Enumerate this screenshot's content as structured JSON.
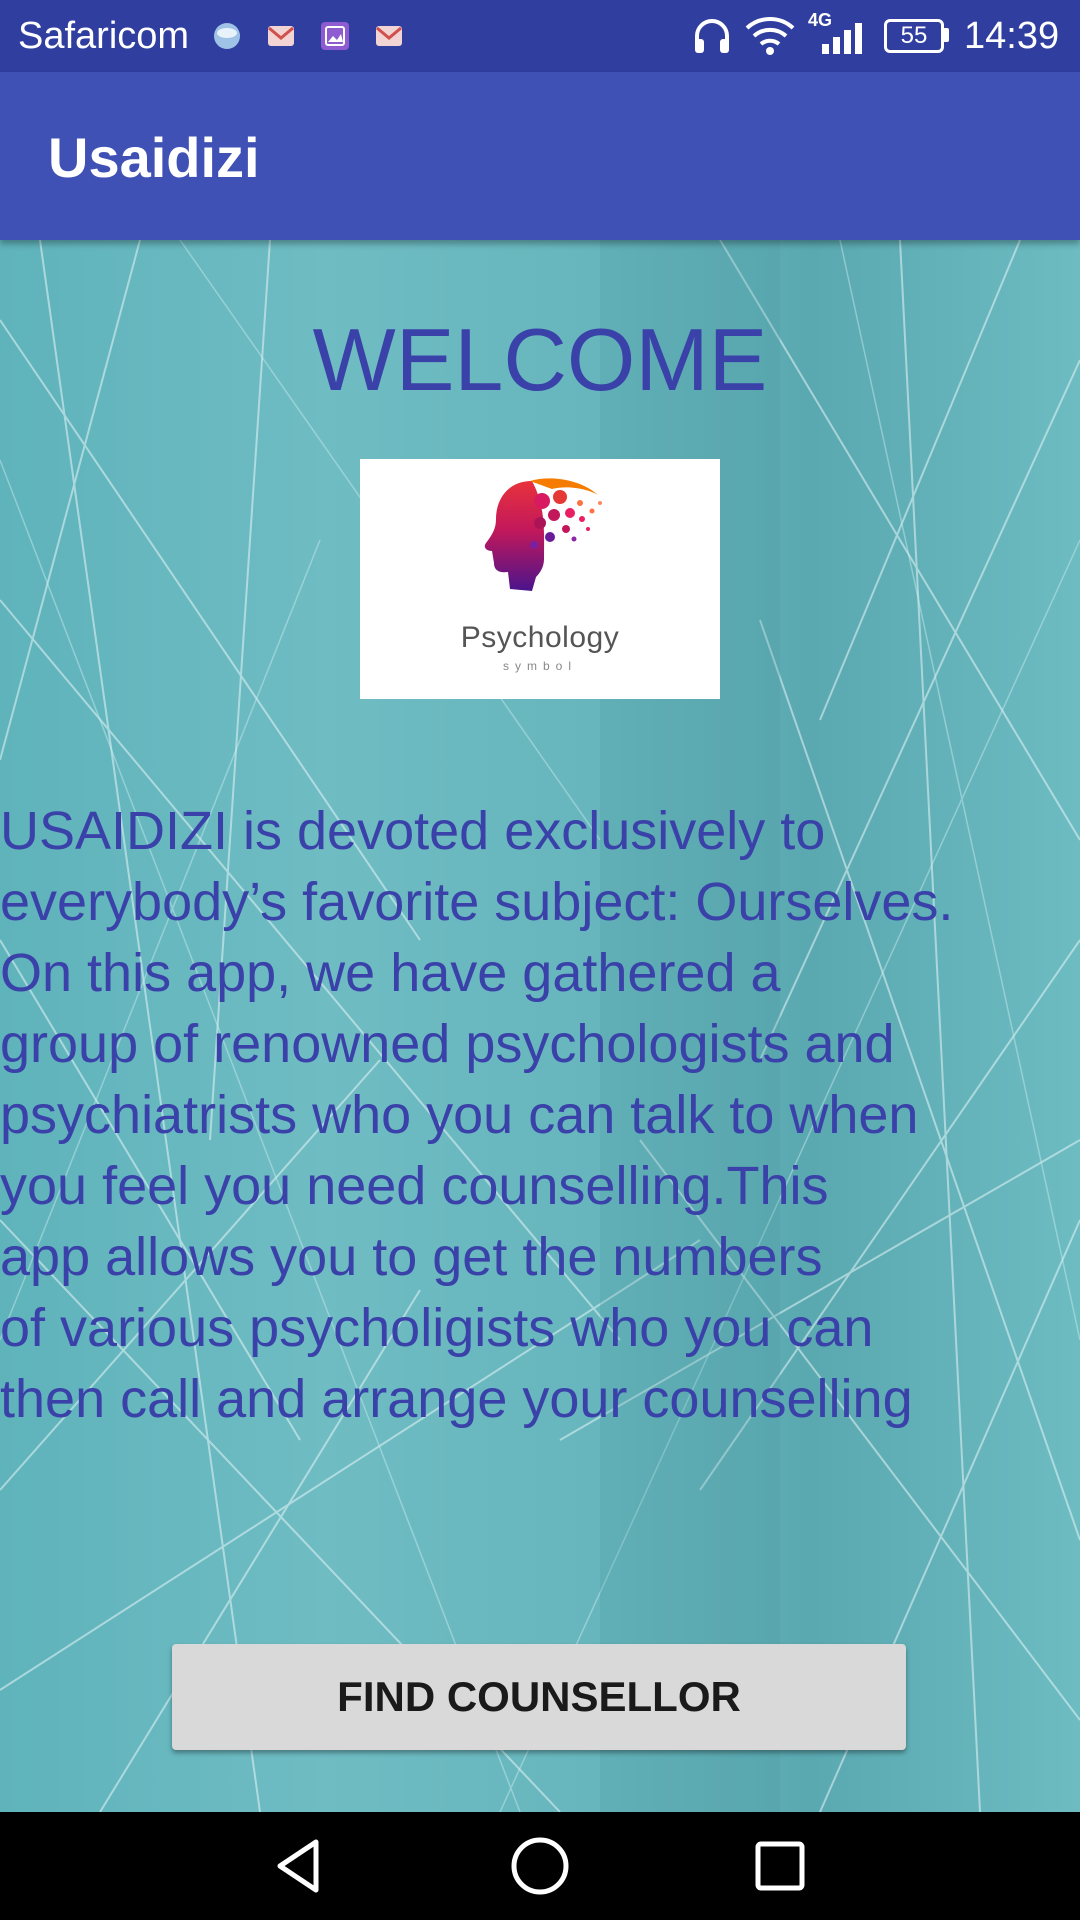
{
  "status_bar": {
    "carrier": "Safaricom",
    "network_type": "4G",
    "battery_level": "55",
    "time": "14:39",
    "notification_icons": [
      "weather-icon",
      "gmail-icon",
      "gallery-icon",
      "gmail-icon"
    ],
    "status_icons": [
      "headphones-icon",
      "wifi-icon",
      "cellular-signal-icon",
      "battery-icon"
    ]
  },
  "app_bar": {
    "title": "Usaidizi",
    "color": "#3F51B5"
  },
  "main": {
    "welcome": "WELCOME",
    "logo": {
      "caption": "Psychology",
      "subcaption": "symbol"
    },
    "description": "USAIDIZI is devoted exclusively to\neverybody’s favorite subject: Ourselves.\nOn this app, we have gathered a\ngroup of renowned psychologists and\npsychiatrists who you can talk to when\nyou feel you need counselling.This\napp allows you to get the numbers\nof various psycholigists who you can\nthen call and arrange your counselling",
    "text_color": "#3a41a8",
    "find_button_label": "FIND COUNSELLOR"
  },
  "nav_bar": {
    "buttons": [
      "back-icon",
      "home-icon",
      "recents-icon"
    ]
  }
}
